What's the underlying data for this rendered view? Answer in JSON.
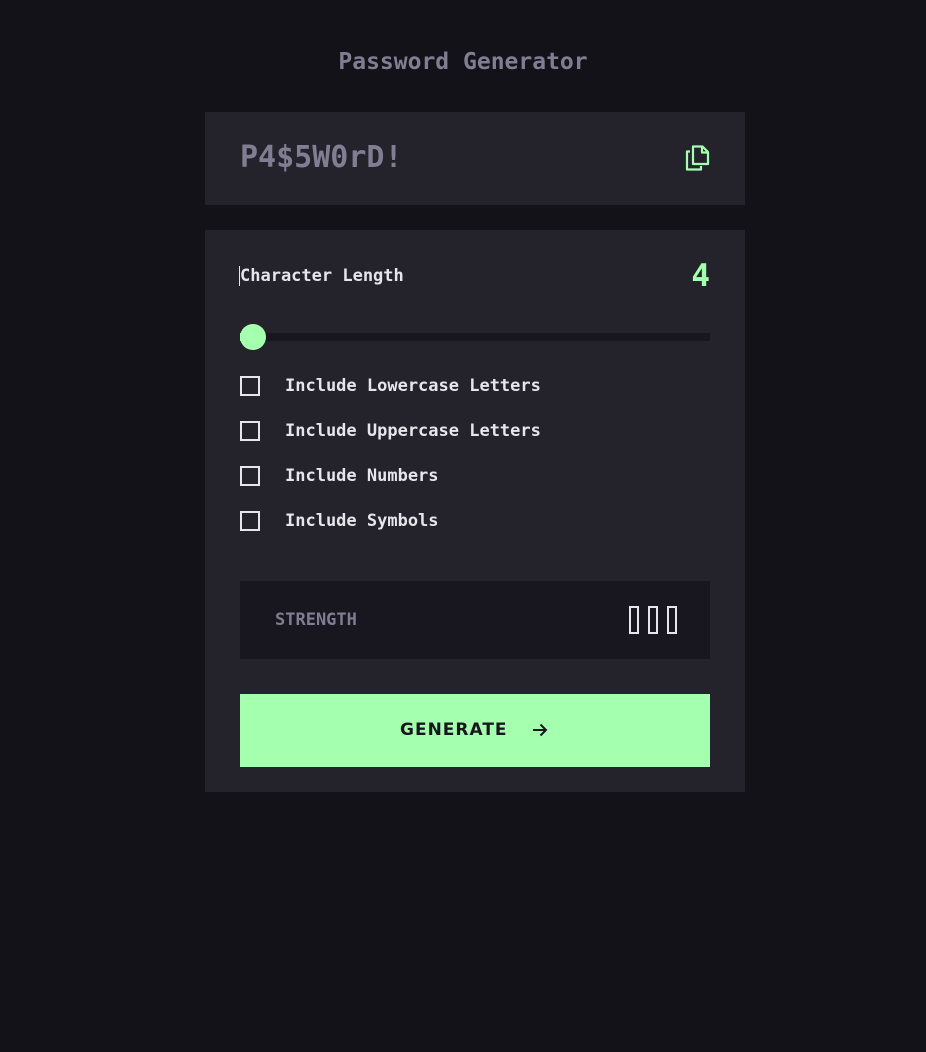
{
  "app": {
    "title": "Password Generator"
  },
  "output": {
    "password": "P4$5W0rD!",
    "copy_icon": "copy-icon"
  },
  "length": {
    "label": "Character Length",
    "value": "4",
    "slider_fraction": 0.0
  },
  "options": [
    {
      "label": "Include Lowercase Letters",
      "checked": false
    },
    {
      "label": "Include Uppercase Letters",
      "checked": false
    },
    {
      "label": "Include Numbers",
      "checked": false
    },
    {
      "label": "Include Symbols",
      "checked": false
    }
  ],
  "strength": {
    "label": "STRENGTH",
    "filled_bars": 0,
    "total_bars": 3
  },
  "generate": {
    "label": "GENERATE",
    "icon": "arrow-right-icon"
  },
  "colors": {
    "background": "#131218",
    "panel": "#24232c",
    "inset": "#18171f",
    "accent": "#a4ffaf",
    "muted": "#817d92",
    "text": "#e6e5ea"
  }
}
